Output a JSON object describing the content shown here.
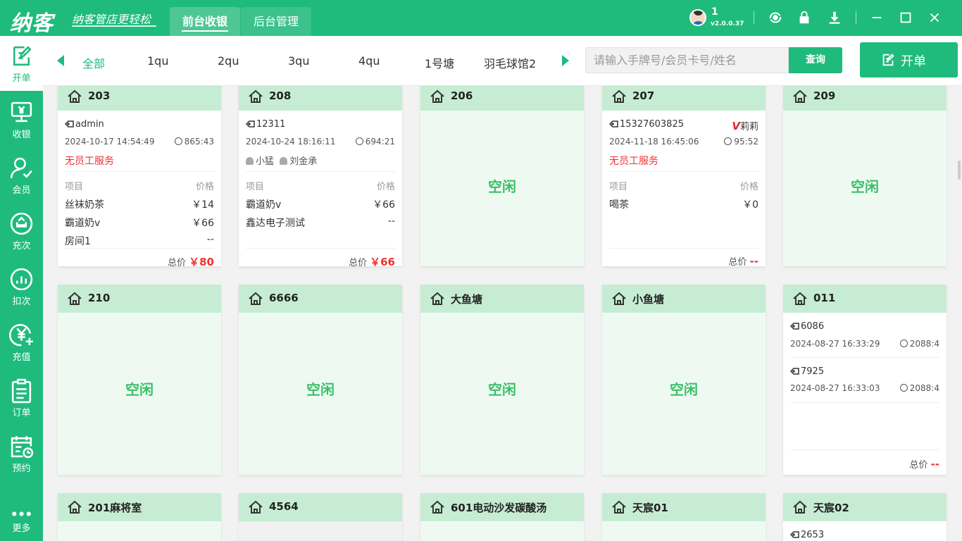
{
  "app": {
    "logo": "纳客",
    "slogan": "纳客管店更轻松",
    "tabs": [
      {
        "label": "前台收银"
      },
      {
        "label": "后台管理"
      }
    ],
    "user": {
      "name": "1",
      "version": "v2.0.0.37"
    }
  },
  "sidebar": [
    {
      "label": "开单"
    },
    {
      "label": "收银"
    },
    {
      "label": "会员"
    },
    {
      "label": "充次"
    },
    {
      "label": "扣次"
    },
    {
      "label": "充值"
    },
    {
      "label": "订单"
    },
    {
      "label": "预约"
    },
    {
      "label": "更多"
    }
  ],
  "categories": [
    "全部",
    "1qu",
    "2qu",
    "3qu",
    "4qu",
    "1号塘",
    "羽毛球馆2"
  ],
  "search": {
    "placeholder": "请输入手牌号/会员卡号/姓名",
    "button": "查询"
  },
  "open_button": "开单",
  "labels": {
    "idle": "空闲",
    "item": "项目",
    "price": "价格",
    "total": "总价",
    "no_staff": "无员工服务"
  },
  "rooms": [
    {
      "name": "203",
      "status": "busy",
      "card": "admin",
      "time": "2024-10-17 14:54:49",
      "duration": "865:43",
      "no_staff": true,
      "items": [
        {
          "name": "丝袜奶茶",
          "price": "￥14"
        },
        {
          "name": "霸道奶v",
          "price": "￥66"
        },
        {
          "name": "房间1",
          "price": "--"
        }
      ],
      "total": "￥80"
    },
    {
      "name": "208",
      "status": "busy",
      "card": "12311",
      "time": "2024-10-24 18:16:11",
      "duration": "694:21",
      "staff": [
        "小猛",
        "刘金承"
      ],
      "items": [
        {
          "name": "霸道奶v",
          "price": "￥66"
        },
        {
          "name": "鑫达电子测试",
          "price": "--"
        }
      ],
      "total": "￥66"
    },
    {
      "name": "206",
      "status": "idle"
    },
    {
      "name": "207",
      "status": "busy",
      "card": "15327603825",
      "member": "莉莉",
      "time": "2024-11-18 16:45:06",
      "duration": "95:52",
      "no_staff": true,
      "items": [
        {
          "name": "喝茶",
          "price": "￥0"
        }
      ],
      "total": "--"
    },
    {
      "name": "209",
      "status": "idle"
    },
    {
      "name": "210",
      "status": "idle"
    },
    {
      "name": "6666",
      "status": "idle"
    },
    {
      "name": "大鱼塘",
      "status": "idle"
    },
    {
      "name": "小鱼塘",
      "status": "idle"
    },
    {
      "name": "011",
      "status": "multi",
      "entries": [
        {
          "card": "6086",
          "time": "2024-08-27 16:33:29",
          "duration": "2088:4"
        },
        {
          "card": "7925",
          "time": "2024-08-27 16:33:03",
          "duration": "2088:4"
        }
      ],
      "total": "--"
    },
    {
      "name": "201麻将室",
      "status": "idle"
    },
    {
      "name": "4564",
      "status": "disabled"
    },
    {
      "name": "601电动沙发碳酸汤",
      "status": "idle"
    },
    {
      "name": "天宸01",
      "status": "idle"
    },
    {
      "name": "天宸02",
      "status": "multi",
      "entries": [
        {
          "card": "2653"
        }
      ]
    }
  ]
}
